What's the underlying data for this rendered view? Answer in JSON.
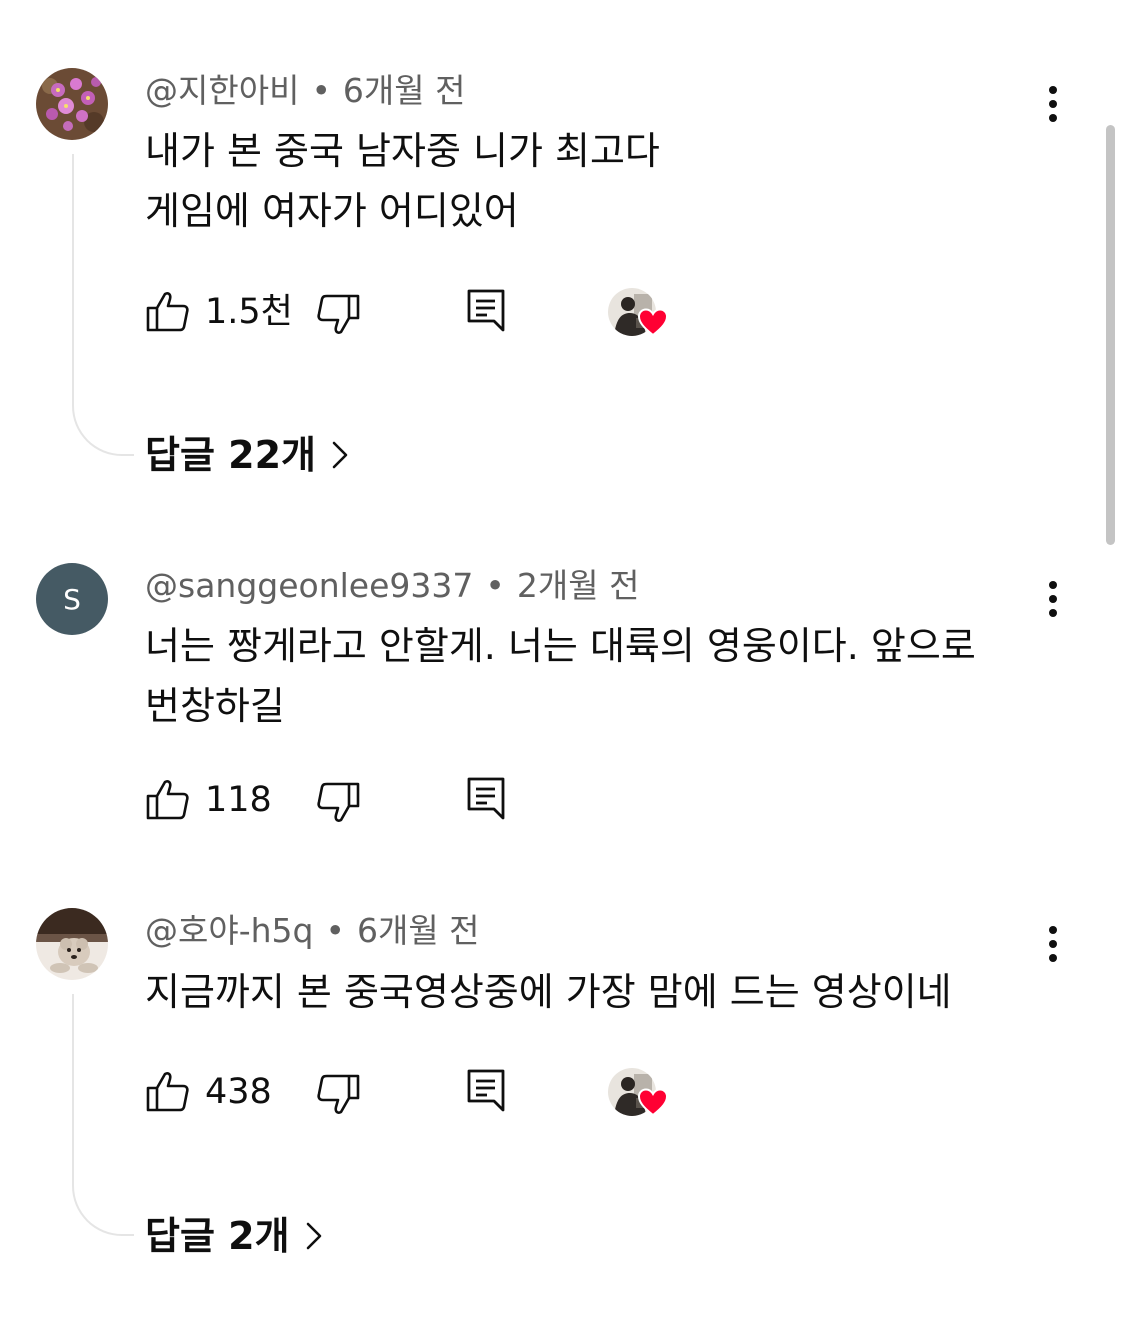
{
  "comments": [
    {
      "author": "@지한아비",
      "separator": "•",
      "time": "6개월 전",
      "avatar_icon": "pink-flowers-avatar",
      "lines": [
        "내가 본 중국 남자중 니가 최고다",
        "게임에 여자가 어디있어"
      ],
      "likes": "1.5천",
      "creator_hearted": true,
      "replies_label": "답글 22개"
    },
    {
      "author": "@sanggeonlee9337",
      "separator": "•",
      "time": "2개월 전",
      "avatar_letter": "S",
      "avatar_color": "#455a64",
      "lines": [
        "너는 짱게라고 안할게. 너는 대륙의 영웅이다. 앞으로",
        "번창하길"
      ],
      "likes": "118",
      "creator_hearted": false
    },
    {
      "author": "@호야-h5q",
      "separator": "•",
      "time": "6개월 전",
      "avatar_icon": "dog-photo-avatar",
      "lines": [
        "지금까지 본 중국영상중에 가장 맘에 드는 영상이네"
      ],
      "likes": "438",
      "creator_hearted": true,
      "replies_label": "답글 2개"
    }
  ],
  "icons": {
    "like": "thumbs-up-icon",
    "dislike": "thumbs-down-icon",
    "reply": "reply-comment-icon",
    "more": "more-vertical-icon",
    "heart": "creator-heart-icon",
    "chevron": "chevron-right-icon"
  },
  "colors": {
    "text": "#0f0f0f",
    "meta": "#606060",
    "heart": "#ff0033",
    "thread_line": "#e5e5e5"
  }
}
